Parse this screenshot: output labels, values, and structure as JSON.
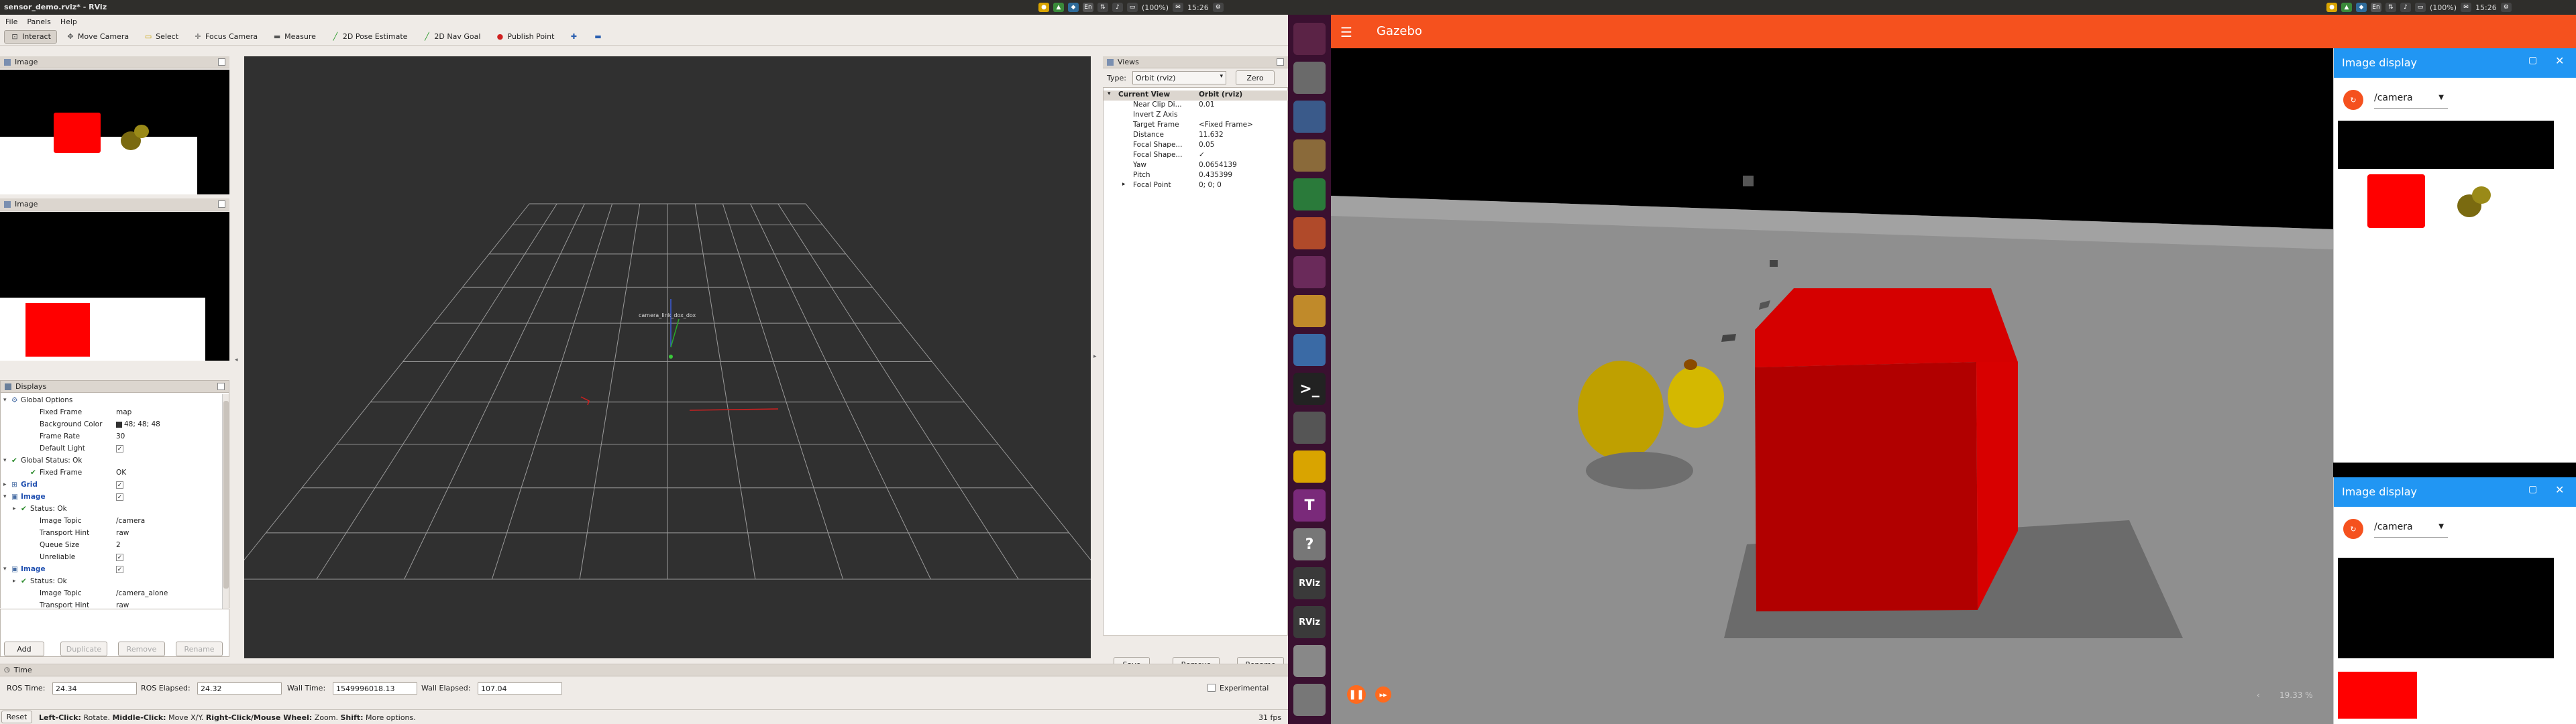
{
  "top_panel": {
    "window_title": "sensor_demo.rviz* - RViz",
    "clock_left": "15:26",
    "clock_right": "15:26",
    "battery_left": "(100%)",
    "battery_right": "(100%)"
  },
  "rviz": {
    "menu": [
      "File",
      "Panels",
      "Help"
    ],
    "toolbar": [
      "Interact",
      "Move Camera",
      "Select",
      "Focus Camera",
      "Measure",
      "2D Pose Estimate",
      "2D Nav Goal",
      "Publish Point"
    ],
    "image_panel_1_title": "Image",
    "image_panel_2_title": "Image",
    "displays": {
      "title": "Displays",
      "rows": [
        {
          "key": "Global Options",
          "value": "",
          "indent": 0,
          "expand": "▾",
          "icon": "gear",
          "bold": false
        },
        {
          "key": "Fixed Frame",
          "value": "map",
          "indent": 2,
          "expand": "",
          "icon": "",
          "bold": false
        },
        {
          "key": "Background Color",
          "value": "48; 48; 48",
          "indent": 2,
          "expand": "",
          "icon": "swatch",
          "bold": false
        },
        {
          "key": "Frame Rate",
          "value": "30",
          "indent": 2,
          "expand": "",
          "icon": "",
          "bold": false
        },
        {
          "key": "Default Light",
          "value": "",
          "indent": 2,
          "expand": "",
          "icon": "check",
          "bold": false
        },
        {
          "key": "Global Status: Ok",
          "value": "",
          "indent": 0,
          "expand": "▾",
          "icon": "ok",
          "bold": false
        },
        {
          "key": "Fixed Frame",
          "value": "OK",
          "indent": 2,
          "expand": "",
          "icon": "ok",
          "bold": false
        },
        {
          "key": "Grid",
          "value": "",
          "indent": 0,
          "expand": "▸",
          "icon": "grid",
          "bold": true
        },
        {
          "key": "Image",
          "value": "",
          "indent": 0,
          "expand": "▾",
          "icon": "image",
          "bold": true
        },
        {
          "key": "Status: Ok",
          "value": "",
          "indent": 1,
          "expand": "▸",
          "icon": "ok",
          "bold": false
        },
        {
          "key": "Image Topic",
          "value": "/camera",
          "indent": 2,
          "expand": "",
          "icon": "",
          "bold": false
        },
        {
          "key": "Transport Hint",
          "value": "raw",
          "indent": 2,
          "expand": "",
          "icon": "",
          "bold": false
        },
        {
          "key": "Queue Size",
          "value": "2",
          "indent": 2,
          "expand": "",
          "icon": "",
          "bold": false
        },
        {
          "key": "Unreliable",
          "value": "",
          "indent": 2,
          "expand": "",
          "icon": "check",
          "bold": false
        },
        {
          "key": "Image",
          "value": "",
          "indent": 0,
          "expand": "▾",
          "icon": "image",
          "bold": true
        },
        {
          "key": "Status: Ok",
          "value": "",
          "indent": 1,
          "expand": "▸",
          "icon": "ok",
          "bold": false
        },
        {
          "key": "Image Topic",
          "value": "/camera_alone",
          "indent": 2,
          "expand": "",
          "icon": "",
          "bold": false
        },
        {
          "key": "Transport Hint",
          "value": "raw",
          "indent": 2,
          "expand": "",
          "icon": "",
          "bold": false
        }
      ],
      "checkbox_rows": [
        4,
        7,
        8,
        13,
        14
      ],
      "buttons": [
        "Add",
        "Duplicate",
        "Remove",
        "Rename"
      ]
    },
    "viewport": {
      "tf_label": "camera_link_dox_dox"
    },
    "views": {
      "title": "Views",
      "type_label": "Type:",
      "type_value": "Orbit (rviz)",
      "zero_label": "Zero",
      "rows": [
        {
          "key": "Current View",
          "value": "Orbit (rviz)"
        },
        {
          "key": "Near Clip Di...",
          "value": "0.01"
        },
        {
          "key": "Invert Z Axis",
          "value": ""
        },
        {
          "key": "Target Frame",
          "value": "<Fixed Frame>"
        },
        {
          "key": "Distance",
          "value": "11.632"
        },
        {
          "key": "Focal Shape...",
          "value": "0.05"
        },
        {
          "key": "Focal Shape...",
          "value": "✓"
        },
        {
          "key": "Yaw",
          "value": "0.0654139"
        },
        {
          "key": "Pitch",
          "value": "0.435399"
        },
        {
          "key": "Focal Point",
          "value": "0; 0; 0"
        }
      ],
      "buttons": [
        "Save",
        "Remove",
        "Rename"
      ]
    },
    "time": {
      "title": "Time",
      "ros_time_label": "ROS Time:",
      "ros_time": "24.34",
      "ros_elapsed_label": "ROS Elapsed:",
      "ros_elapsed": "24.32",
      "wall_time_label": "Wall Time:",
      "wall_time": "1549996018.13",
      "wall_elapsed_label": "Wall Elapsed:",
      "wall_elapsed": "107.04",
      "experimental_label": "Experimental"
    },
    "status": {
      "reset": "Reset",
      "hint_bold_1": "Left-Click:",
      "hint_1": "Rotate.",
      "hint_bold_2": "Middle-Click:",
      "hint_2": "Move X/Y.",
      "hint_bold_3": "Right-Click/Mouse Wheel:",
      "hint_3": "Zoom.",
      "hint_bold_4": "Shift:",
      "hint_4": "More options.",
      "fps": "31 fps"
    }
  },
  "launcher": {
    "icons": [
      "ubuntu-dash-icon",
      "files-drive-icon",
      "text-editor-icon",
      "archive-icon",
      "spreadsheet-icon",
      "presentation-icon",
      "settings-icon",
      "package-icon",
      "browser-icon",
      "terminal-icon",
      "calculator-icon",
      "chrome-icon",
      "text-tool-icon",
      "help-icon",
      "rviz-icon",
      "rviz-icon-2",
      "drive-icon",
      "trash-icon"
    ],
    "labels": [
      "",
      "",
      "",
      "",
      "",
      "",
      "",
      "",
      "",
      ">_",
      "",
      "",
      "T",
      "?",
      "RViz",
      "RViz",
      "",
      ""
    ]
  },
  "gazebo": {
    "title": "Gazebo",
    "zoom": "19.33 %",
    "image_displays": [
      {
        "title": "Image display",
        "topic": "/camera"
      },
      {
        "title": "Image display",
        "topic": "/camera"
      }
    ],
    "colors": {
      "header": "#f5511e",
      "panel_header": "#2196f3",
      "box": "#c00000",
      "duck": "#d4b800"
    }
  }
}
